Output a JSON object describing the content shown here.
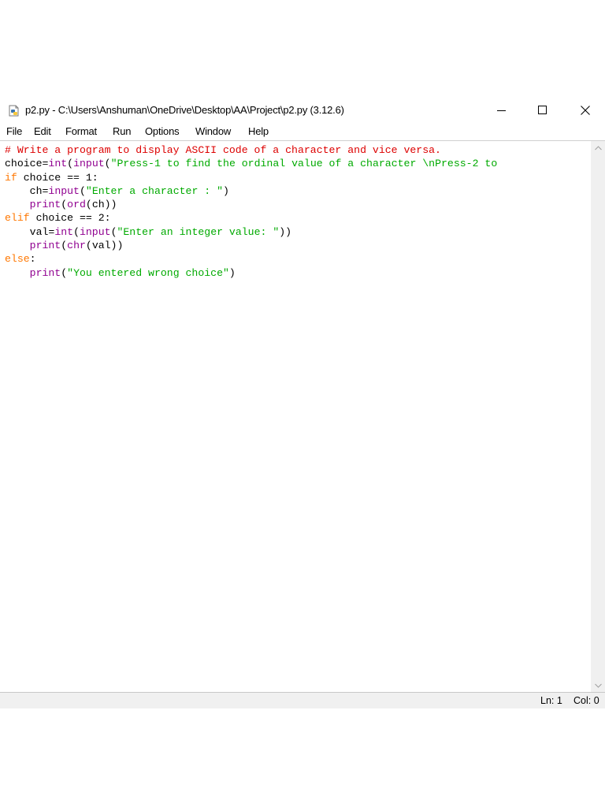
{
  "window": {
    "title": "p2.py - C:\\Users\\Anshuman\\OneDrive\\Desktop\\AA\\Project\\p2.py (3.12.6)",
    "icon": "python-file-icon"
  },
  "menu": {
    "items": [
      "File",
      "Edit",
      "Format",
      "Run",
      "Options",
      "Window",
      "Help"
    ]
  },
  "colors": {
    "comment": "#dd0000",
    "keyword": "#ff7700",
    "builtin": "#900090",
    "string": "#00aa00",
    "default": "#000000"
  },
  "code": {
    "lines": [
      [
        {
          "t": "comment",
          "s": "# Write a program to display ASCII code of a character and vice versa."
        }
      ],
      [
        {
          "t": "default",
          "s": "choice="
        },
        {
          "t": "builtin",
          "s": "int"
        },
        {
          "t": "default",
          "s": "("
        },
        {
          "t": "builtin",
          "s": "input"
        },
        {
          "t": "default",
          "s": "("
        },
        {
          "t": "string",
          "s": "\"Press-1 to find the ordinal value of a character \\nPress-2 to"
        }
      ],
      [
        {
          "t": "keyword",
          "s": "if"
        },
        {
          "t": "default",
          "s": " choice == 1:"
        }
      ],
      [
        {
          "t": "default",
          "s": "    ch="
        },
        {
          "t": "builtin",
          "s": "input"
        },
        {
          "t": "default",
          "s": "("
        },
        {
          "t": "string",
          "s": "\"Enter a character : \""
        },
        {
          "t": "default",
          "s": ")"
        }
      ],
      [
        {
          "t": "default",
          "s": "    "
        },
        {
          "t": "builtin",
          "s": "print"
        },
        {
          "t": "default",
          "s": "("
        },
        {
          "t": "builtin",
          "s": "ord"
        },
        {
          "t": "default",
          "s": "(ch))"
        }
      ],
      [
        {
          "t": "keyword",
          "s": "elif"
        },
        {
          "t": "default",
          "s": " choice == 2:"
        }
      ],
      [
        {
          "t": "default",
          "s": "    val="
        },
        {
          "t": "builtin",
          "s": "int"
        },
        {
          "t": "default",
          "s": "("
        },
        {
          "t": "builtin",
          "s": "input"
        },
        {
          "t": "default",
          "s": "("
        },
        {
          "t": "string",
          "s": "\"Enter an integer value: \""
        },
        {
          "t": "default",
          "s": "))"
        }
      ],
      [
        {
          "t": "default",
          "s": "    "
        },
        {
          "t": "builtin",
          "s": "print"
        },
        {
          "t": "default",
          "s": "("
        },
        {
          "t": "builtin",
          "s": "chr"
        },
        {
          "t": "default",
          "s": "(val))"
        }
      ],
      [
        {
          "t": "keyword",
          "s": "else"
        },
        {
          "t": "default",
          "s": ":"
        }
      ],
      [
        {
          "t": "default",
          "s": "    "
        },
        {
          "t": "builtin",
          "s": "print"
        },
        {
          "t": "default",
          "s": "("
        },
        {
          "t": "string",
          "s": "\"You entered wrong choice\""
        },
        {
          "t": "default",
          "s": ")"
        }
      ]
    ]
  },
  "status": {
    "ln": "Ln: 1",
    "col": "Col: 0"
  }
}
